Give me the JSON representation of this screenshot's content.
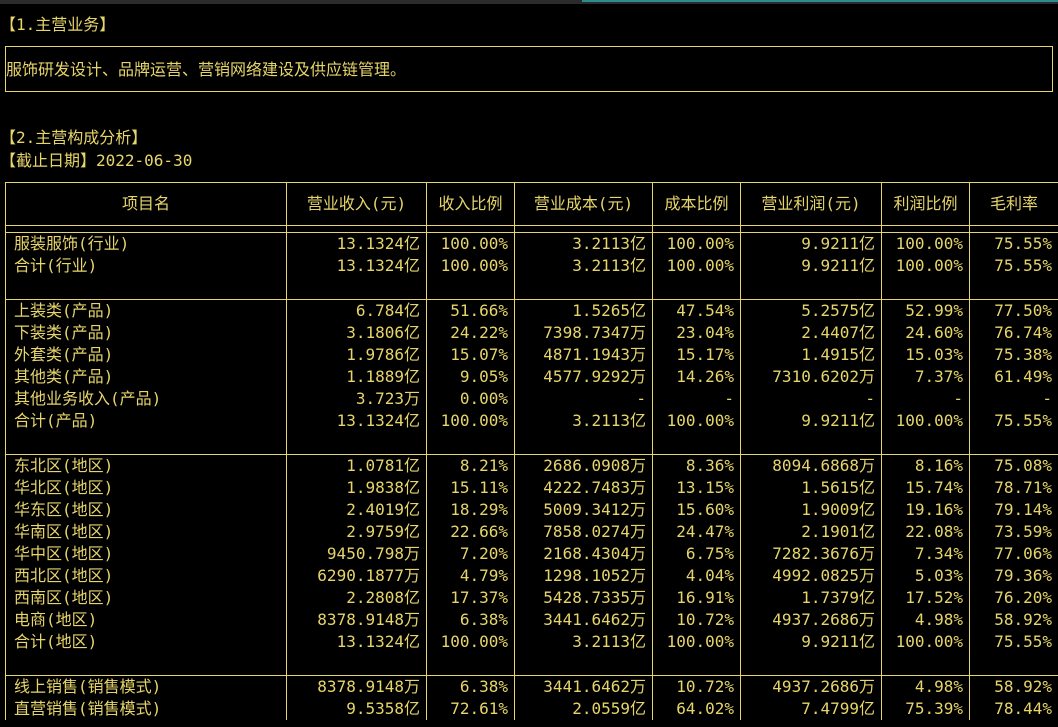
{
  "section1": {
    "title": "【1.主营业务】",
    "content": "服饰研发设计、品牌运营、营销网络建设及供应链管理。"
  },
  "section2": {
    "title": "【2.主营构成分析】",
    "date_label": "【截止日期】2022-06-30"
  },
  "table": {
    "headers": [
      "项目名",
      "营业收入(元)",
      "收入比例",
      "营业成本(元)",
      "成本比例",
      "营业利润(元)",
      "利润比例",
      "毛利率"
    ],
    "groups": [
      {
        "rows": [
          [
            "服装服饰(行业)",
            "13.1324亿",
            "100.00%",
            "3.2113亿",
            "100.00%",
            "9.9211亿",
            "100.00%",
            "75.55%"
          ],
          [
            "合计(行业)",
            "13.1324亿",
            "100.00%",
            "3.2113亿",
            "100.00%",
            "9.9211亿",
            "100.00%",
            "75.55%"
          ]
        ]
      },
      {
        "rows": [
          [
            "上装类(产品)",
            "6.784亿",
            "51.66%",
            "1.5265亿",
            "47.54%",
            "5.2575亿",
            "52.99%",
            "77.50%"
          ],
          [
            "下装类(产品)",
            "3.1806亿",
            "24.22%",
            "7398.7347万",
            "23.04%",
            "2.4407亿",
            "24.60%",
            "76.74%"
          ],
          [
            "外套类(产品)",
            "1.9786亿",
            "15.07%",
            "4871.1943万",
            "15.17%",
            "1.4915亿",
            "15.03%",
            "75.38%"
          ],
          [
            "其他类(产品)",
            "1.1889亿",
            "9.05%",
            "4577.9292万",
            "14.26%",
            "7310.6202万",
            "7.37%",
            "61.49%"
          ],
          [
            "其他业务收入(产品)",
            "3.723万",
            "0.00%",
            "-",
            "-",
            "-",
            "-",
            "-"
          ],
          [
            "合计(产品)",
            "13.1324亿",
            "100.00%",
            "3.2113亿",
            "100.00%",
            "9.9211亿",
            "100.00%",
            "75.55%"
          ]
        ]
      },
      {
        "rows": [
          [
            "东北区(地区)",
            "1.0781亿",
            "8.21%",
            "2686.0908万",
            "8.36%",
            "8094.6868万",
            "8.16%",
            "75.08%"
          ],
          [
            "华北区(地区)",
            "1.9838亿",
            "15.11%",
            "4222.7483万",
            "13.15%",
            "1.5615亿",
            "15.74%",
            "78.71%"
          ],
          [
            "华东区(地区)",
            "2.4019亿",
            "18.29%",
            "5009.3412万",
            "15.60%",
            "1.9009亿",
            "19.16%",
            "79.14%"
          ],
          [
            "华南区(地区)",
            "2.9759亿",
            "22.66%",
            "7858.0274万",
            "24.47%",
            "2.1901亿",
            "22.08%",
            "73.59%"
          ],
          [
            "华中区(地区)",
            "9450.798万",
            "7.20%",
            "2168.4304万",
            "6.75%",
            "7282.3676万",
            "7.34%",
            "77.06%"
          ],
          [
            "西北区(地区)",
            "6290.1877万",
            "4.79%",
            "1298.1052万",
            "4.04%",
            "4992.0825万",
            "5.03%",
            "79.36%"
          ],
          [
            "西南区(地区)",
            "2.2808亿",
            "17.37%",
            "5428.7335万",
            "16.91%",
            "1.7379亿",
            "17.52%",
            "76.20%"
          ],
          [
            "电商(地区)",
            "8378.9148万",
            "6.38%",
            "3441.6462万",
            "10.72%",
            "4937.2686万",
            "4.98%",
            "58.92%"
          ],
          [
            "合计(地区)",
            "13.1324亿",
            "100.00%",
            "3.2113亿",
            "100.00%",
            "9.9211亿",
            "100.00%",
            "75.55%"
          ]
        ]
      },
      {
        "rows": [
          [
            "线上销售(销售模式)",
            "8378.9148万",
            "6.38%",
            "3441.6462万",
            "10.72%",
            "4937.2686万",
            "4.98%",
            "58.92%"
          ],
          [
            "直营销售(销售模式)",
            "9.5358亿",
            "72.61%",
            "2.0559亿",
            "64.02%",
            "7.4799亿",
            "75.39%",
            "78.44%"
          ]
        ]
      }
    ]
  },
  "colors": {
    "background": "#000000",
    "text": "#e6d56a",
    "accent": "#2a8c8c"
  }
}
